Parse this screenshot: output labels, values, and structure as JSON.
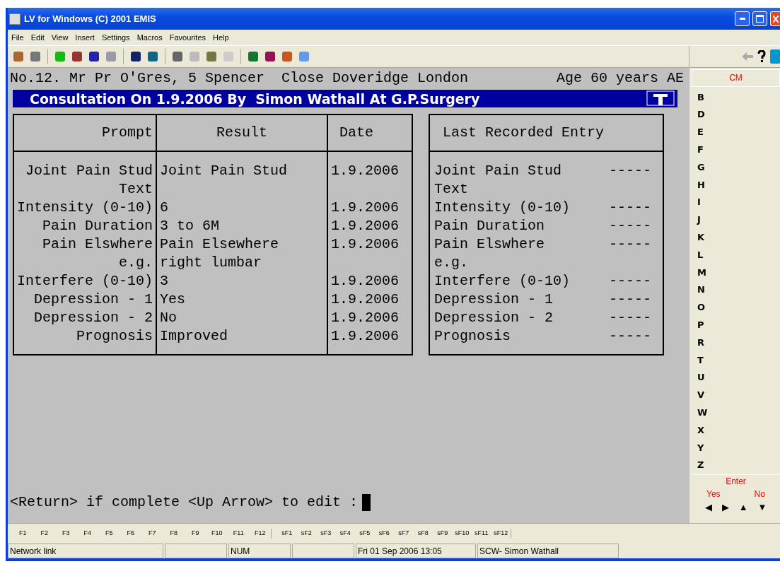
{
  "window": {
    "title": "LV for Windows (C) 2001 EMIS"
  },
  "menu": [
    "File",
    "Edit",
    "View",
    "Insert",
    "Settings",
    "Macros",
    "Favourites",
    "Help"
  ],
  "patient_line": {
    "text": "No.12. Mr Pr O'Gres, 5 Spencer  Close Doveridge London",
    "age": "Age 60 years AE"
  },
  "consultation_title": "Consultation On 1.9.2006 By  Simon Wathall At G.P.Surgery",
  "table": {
    "columns": [
      "Prompt",
      "Result",
      "Date"
    ],
    "rows": [
      {
        "prompt": "Joint Pain Stud",
        "result": "Joint Pain Stud",
        "date": "1.9.2006"
      },
      {
        "prompt": "Text"
      },
      {
        "prompt": "Intensity (0-10)",
        "result": "6",
        "date": "1.9.2006"
      },
      {
        "prompt": "Pain Duration",
        "result": "3 to 6M",
        "date": "1.9.2006"
      },
      {
        "prompt": "Pain Elswhere",
        "result": "Pain Elsewhere",
        "date": "1.9.2006"
      },
      {
        "prompt": "e.g.",
        "result": "right lumbar"
      },
      {
        "prompt": "Interfere (0-10)",
        "result": "3",
        "date": "1.9.2006"
      },
      {
        "prompt": "Depression - 1",
        "result": "Yes",
        "date": "1.9.2006"
      },
      {
        "prompt": "Depression - 2",
        "result": "No",
        "date": "1.9.2006"
      },
      {
        "prompt": "Prognosis",
        "result": "Improved",
        "date": "1.9.2006"
      }
    ]
  },
  "last_recorded": {
    "heading": "Last Recorded Entry",
    "rows": [
      {
        "entry": "Joint Pain Stud",
        "value": "-----"
      },
      {
        "entry": "Text"
      },
      {
        "entry": "Intensity (0-10)",
        "value": "-----"
      },
      {
        "entry": "Pain Duration",
        "value": "-----"
      },
      {
        "entry": "Pain Elswhere",
        "value": "-----"
      },
      {
        "entry": "e.g."
      },
      {
        "entry": "Interfere (0-10)",
        "value": "-----"
      },
      {
        "entry": "Depression - 1",
        "value": "-----"
      },
      {
        "entry": "Depression - 2",
        "value": "-----"
      },
      {
        "entry": "Prognosis",
        "value": "-----"
      }
    ]
  },
  "prompt_line": "<Return> if complete <Up Arrow> to edit :",
  "side_panel": {
    "header": "CM",
    "letters": [
      "B",
      "D",
      "E",
      "F",
      "G",
      "H",
      "I",
      "J",
      "K",
      "L",
      "M",
      "N",
      "O",
      "P",
      "R",
      "T",
      "U",
      "V",
      "W",
      "X",
      "Y",
      "Z"
    ],
    "enter": "Enter",
    "yes": "Yes",
    "no": "No",
    "arrows": [
      "◀",
      "▶",
      "▲",
      "▼"
    ]
  },
  "function_keys": [
    "F1",
    "F2",
    "F3",
    "F4",
    "F5",
    "F6",
    "F7",
    "F8",
    "F9",
    "F10",
    "F11",
    "F12"
  ],
  "shift_function_keys": [
    "sF1",
    "sF2",
    "sF3",
    "sF4",
    "sF5",
    "sF6",
    "sF7",
    "sF8",
    "sF9",
    "sF10",
    "sF11",
    "sF12"
  ],
  "status_bar": [
    {
      "kind": "text",
      "text": "Network link"
    },
    {
      "kind": "blank"
    },
    {
      "kind": "text",
      "text": "NUM"
    },
    {
      "kind": "blank"
    },
    {
      "kind": "text",
      "text": "Fri 01 Sep 2006 13:05"
    },
    {
      "kind": "text",
      "text": "SCW- Simon Wathall"
    }
  ]
}
